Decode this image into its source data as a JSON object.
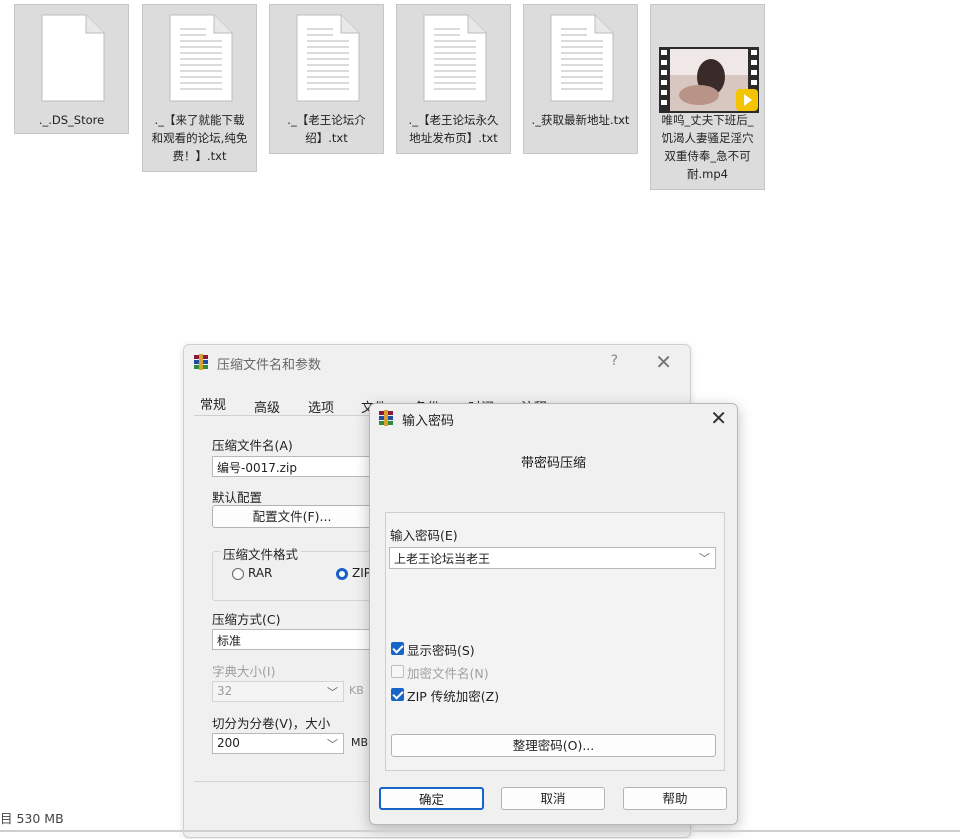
{
  "files": [
    {
      "name": "._.DS_Store",
      "type": "blank-file-icon"
    },
    {
      "name": "._【来了就能下载和观看的论坛,纯免费！】.txt",
      "type": "text-file-icon"
    },
    {
      "name": "._【老王论坛介绍】.txt",
      "type": "text-file-icon"
    },
    {
      "name": "._【老王论坛永久地址发布页】.txt",
      "type": "text-file-icon"
    },
    {
      "name": "._获取最新地址.txt",
      "type": "text-file-icon"
    },
    {
      "name": "唯呜_丈夫下班后_饥渴人妻骚足淫穴双重侍奉_急不可耐.mp4",
      "type": "video-file-icon",
      "badge": "Player"
    }
  ],
  "status": {
    "text": "目 530 MB"
  },
  "archive_dialog": {
    "title": "压缩文件名和参数",
    "help": "?",
    "close": "✕",
    "tabs": [
      "常规",
      "高级",
      "选项",
      "文件",
      "备份",
      "时间",
      "注释"
    ],
    "archive_name_label": "压缩文件名(A)",
    "archive_name_value": "编号-0017.zip",
    "default_profile_label": "默认配置",
    "profile_button": "配置文件(F)...",
    "format_label": "压缩文件格式",
    "format_options": [
      "RAR",
      "ZIP"
    ],
    "format_selected": "ZIP",
    "method_label": "压缩方式(C)",
    "method_value": "标准",
    "dict_label": "字典大小(I)",
    "dict_value": "32",
    "dict_unit": "KB",
    "split_label": "切分为分卷(V)，大小",
    "split_value": "200",
    "split_unit": "MB"
  },
  "password_dialog": {
    "title": "输入密码",
    "close": "✕",
    "heading": "带密码压缩",
    "password_label": "输入密码(E)",
    "password_value": "上老王论坛当老王",
    "show_password": {
      "label": "显示密码(S)",
      "checked": true
    },
    "encrypt_names": {
      "label": "加密文件名(N)",
      "checked": false,
      "disabled": true
    },
    "zip_legacy": {
      "label": "ZIP 传统加密(Z)",
      "checked": true
    },
    "organize_button": "整理密码(O)...",
    "ok_button": "确定",
    "cancel_button": "取消",
    "help_button": "帮助"
  },
  "colors": {
    "accent": "#1765c9",
    "tile_bg": "#dcdcdc",
    "dialog_bg": "#f0f0f0"
  }
}
